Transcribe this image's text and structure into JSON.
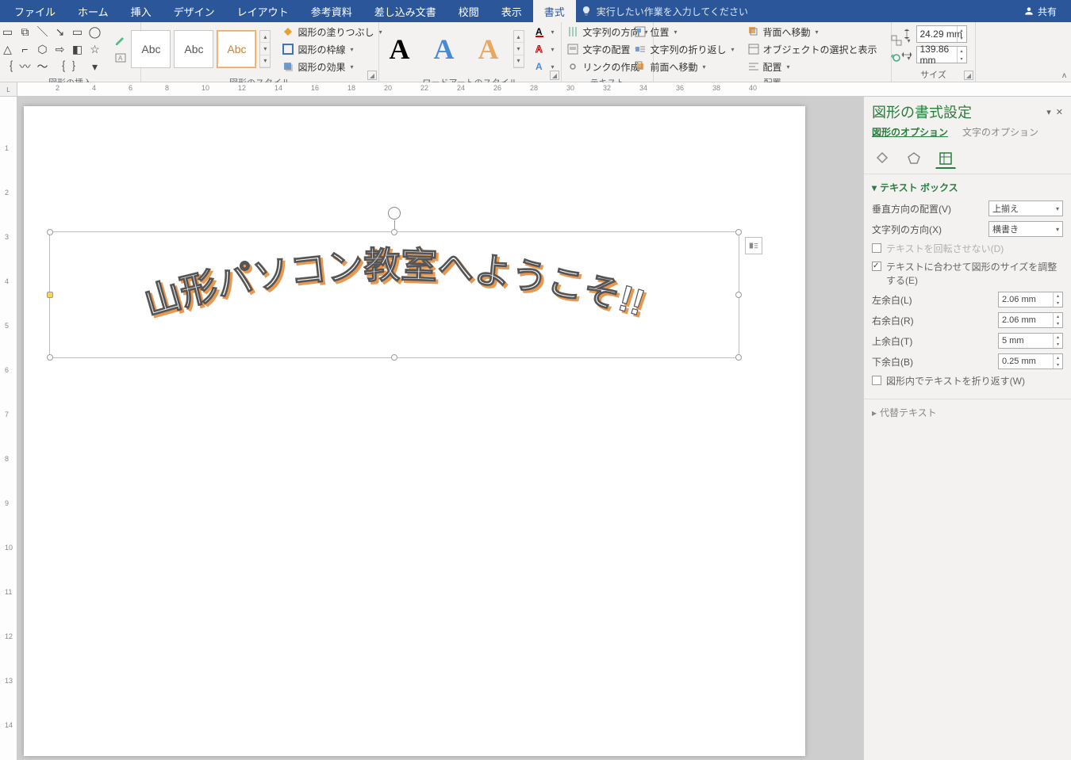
{
  "menubar": {
    "tabs": [
      "ファイル",
      "ホーム",
      "挿入",
      "デザイン",
      "レイアウト",
      "参考資料",
      "差し込み文書",
      "校閲",
      "表示",
      "書式"
    ],
    "active_index": 9,
    "tell_me_placeholder": "実行したい作業を入力してください",
    "share": "共有"
  },
  "ribbon": {
    "groups": {
      "insert_shapes": "図形の挿入",
      "shape_styles": "図形のスタイル",
      "wordart_styles": "ワードアートのスタイル",
      "text": "テキスト",
      "arrange": "配置",
      "size": "サイズ"
    },
    "shape_fill": "図形の塗りつぶし",
    "shape_outline": "図形の枠線",
    "shape_effects": "図形の効果",
    "style_label": "Abc",
    "text_direction": "文字列の方向",
    "align_text": "文字の配置",
    "create_link": "リンクの作成",
    "position": "位置",
    "wrap_text": "文字列の折り返し",
    "bring_forward": "前面へ移動",
    "send_backward": "背面へ移動",
    "selection_pane": "オブジェクトの選択と表示",
    "align": "配置",
    "size_height": "24.29 mm",
    "size_width": "139.86 mm"
  },
  "document": {
    "wordart_text": "山形パソコン教室へようこそ!!"
  },
  "pane": {
    "title": "図形の書式設定",
    "tab_shape": "図形のオプション",
    "tab_text": "文字のオプション",
    "section_textbox": "テキスト ボックス",
    "v_align_label": "垂直方向の配置(V)",
    "v_align_value": "上揃え",
    "text_dir_label": "文字列の方向(X)",
    "text_dir_value": "横書き",
    "no_rotate": "テキストを回転させない(D)",
    "autofit": "テキストに合わせて図形のサイズを調整する(E)",
    "margin_left_label": "左余白(L)",
    "margin_left_value": "2.06 mm",
    "margin_right_label": "右余白(R)",
    "margin_right_value": "2.06 mm",
    "margin_top_label": "上余白(T)",
    "margin_top_value": "5 mm",
    "margin_bottom_label": "下余白(B)",
    "margin_bottom_value": "0.25 mm",
    "wrap_in_shape": "図形内でテキストを折り返す(W)",
    "section_alt": "代替テキスト"
  },
  "ruler_h": [
    2,
    4,
    6,
    8,
    10,
    12,
    14,
    16,
    18,
    20,
    22,
    24,
    26,
    28,
    30,
    32,
    34,
    36,
    38,
    40
  ],
  "ruler_v": [
    1,
    2,
    3,
    4,
    5,
    6,
    7,
    8,
    9,
    10,
    11,
    12,
    13,
    14
  ]
}
